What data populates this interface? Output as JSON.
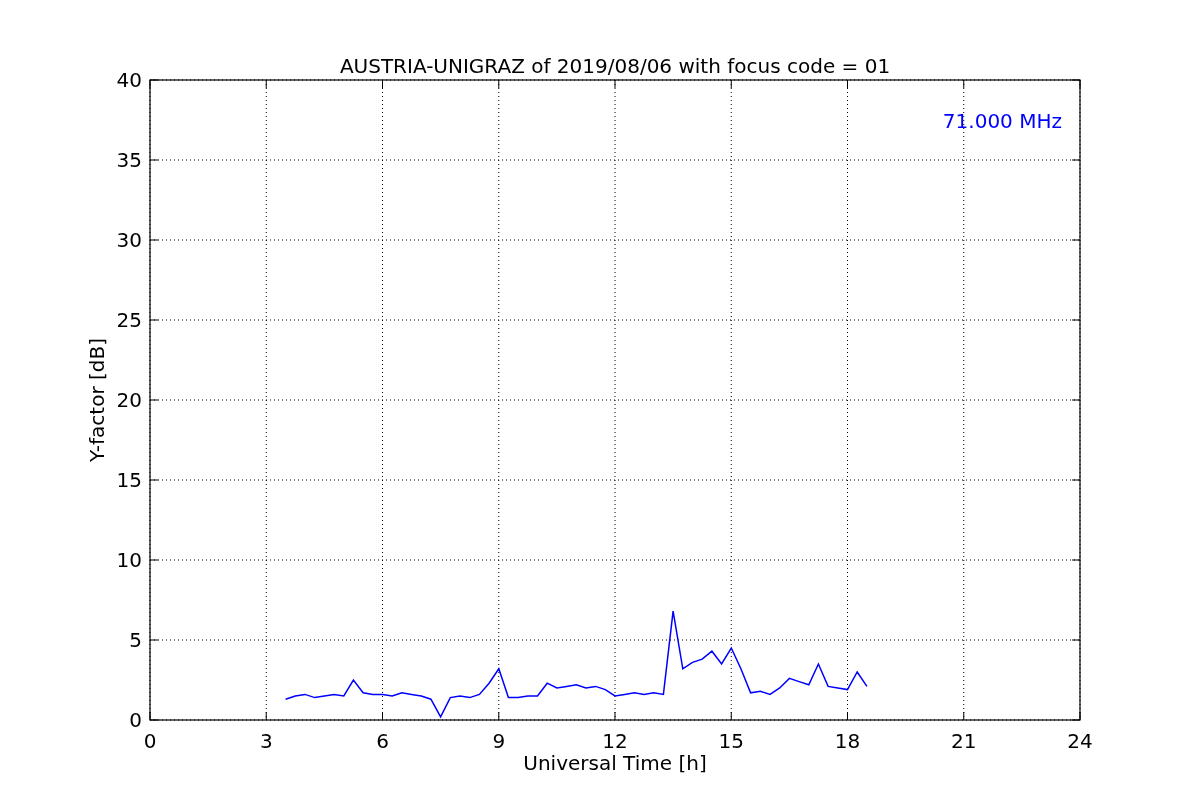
{
  "figure": {
    "chart_data": {
      "type": "line",
      "title": "AUSTRIA-UNIGRAZ of 2019/08/06 with focus code = 01",
      "xlabel": "Universal Time [h]",
      "ylabel": "Y-factor [dB]",
      "x": [
        3.5,
        3.75,
        4,
        4.25,
        4.5,
        4.75,
        5,
        5.25,
        5.5,
        5.75,
        6,
        6.25,
        6.5,
        6.75,
        7,
        7.25,
        7.5,
        7.75,
        8,
        8.25,
        8.5,
        8.75,
        9,
        9.25,
        9.5,
        9.75,
        10,
        10.25,
        10.5,
        10.75,
        11,
        11.25,
        11.5,
        11.75,
        12,
        12.25,
        12.5,
        12.75,
        13,
        13.25,
        13.5,
        13.75,
        14,
        14.25,
        14.5,
        14.75,
        15,
        15.25,
        15.5,
        15.75,
        16,
        16.25,
        16.5,
        16.75,
        17,
        17.25,
        17.5,
        17.75,
        18,
        18.25,
        18.5
      ],
      "series": [
        {
          "color": "#0000ff",
          "values": [
            1.3,
            1.5,
            1.6,
            1.4,
            1.5,
            1.6,
            1.5,
            2.5,
            1.7,
            1.6,
            1.6,
            1.5,
            1.7,
            1.6,
            1.5,
            1.3,
            0.2,
            1.4,
            1.5,
            1.4,
            1.6,
            2.3,
            3.2,
            1.4,
            1.4,
            1.5,
            1.5,
            2.3,
            2.0,
            2.1,
            2.2,
            2.0,
            2.1,
            1.9,
            1.5,
            1.6,
            1.7,
            1.6,
            1.7,
            1.6,
            6.8,
            3.2,
            3.6,
            3.8,
            4.3,
            3.5,
            4.5,
            3.2,
            1.7,
            1.8,
            1.6,
            2.0,
            2.6,
            2.4,
            2.2,
            3.5,
            2.1,
            2.0,
            1.9,
            3.0,
            2.1
          ]
        }
      ],
      "xlim": [
        0,
        24
      ],
      "ylim": [
        0,
        40
      ],
      "xticks": [
        0,
        3,
        6,
        9,
        12,
        15,
        18,
        21,
        24
      ],
      "yticks": [
        0,
        5,
        10,
        15,
        20,
        25,
        30,
        35,
        40
      ],
      "grid": true,
      "annotations": [
        "71.000 MHz"
      ]
    }
  }
}
